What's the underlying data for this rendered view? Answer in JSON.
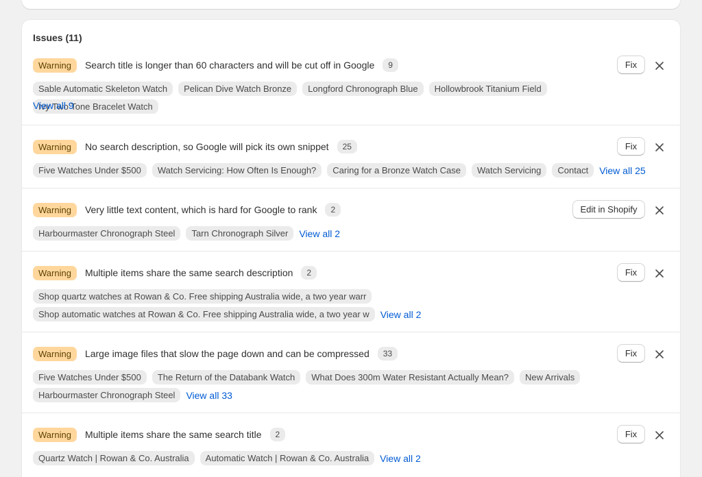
{
  "header": {
    "title": "Issues (11)"
  },
  "issues": [
    {
      "badge": "Warning",
      "text": "Search title is longer than 60 characters and will be cut off in Google",
      "count": "9",
      "action": "Fix",
      "chips": [
        "Sable Automatic Skeleton Watch",
        "Pelican Dive Watch Bronze",
        "Longford Chronograph Blue",
        "Hollowbrook Titanium Field",
        "Ivy Two Tone Bracelet Watch"
      ],
      "view_all": "View all 9"
    },
    {
      "badge": "Warning",
      "text": "No search description, so Google will pick its own snippet",
      "count": "25",
      "action": "Fix",
      "chips": [
        "Five Watches Under $500",
        "Watch Servicing: How Often Is Enough?",
        "Caring for a Bronze Watch Case",
        "Watch Servicing",
        "Contact"
      ],
      "view_all": "View all 25"
    },
    {
      "badge": "Warning",
      "text": "Very little text content, which is hard for Google to rank",
      "count": "2",
      "action": "Edit in Shopify",
      "chips": [
        "Harbourmaster Chronograph Steel",
        "Tarn Chronograph Silver"
      ],
      "view_all": "View all 2"
    },
    {
      "badge": "Warning",
      "text": "Multiple items share the same search description",
      "count": "2",
      "action": "Fix",
      "chips": [
        "Shop quartz watches at Rowan & Co. Free shipping Australia wide, a two year warr",
        "Shop automatic watches at Rowan & Co. Free shipping Australia wide, a two year w"
      ],
      "view_all": "View all 2"
    },
    {
      "badge": "Warning",
      "text": "Large image files that slow the page down and can be compressed",
      "count": "33",
      "action": "Fix",
      "chips": [
        "Five Watches Under $500",
        "The Return of the Databank Watch",
        "What Does 300m Water Resistant Actually Mean?",
        "New Arrivals",
        "Harbourmaster Chronograph Steel"
      ],
      "view_all": "View all 33"
    },
    {
      "badge": "Warning",
      "text": "Multiple items share the same search title",
      "count": "2",
      "action": "Fix",
      "chips": [
        "Quartz Watch | Rowan & Co. Australia",
        "Automatic Watch | Rowan & Co. Australia"
      ],
      "view_all": "View all 2"
    }
  ],
  "icons": {
    "dismiss": "close-icon"
  },
  "colors": {
    "warning_bg": "#ffd79d",
    "warning_text": "#5e4200",
    "link": "#005bd3",
    "chip_bg": "#ebebeb"
  }
}
